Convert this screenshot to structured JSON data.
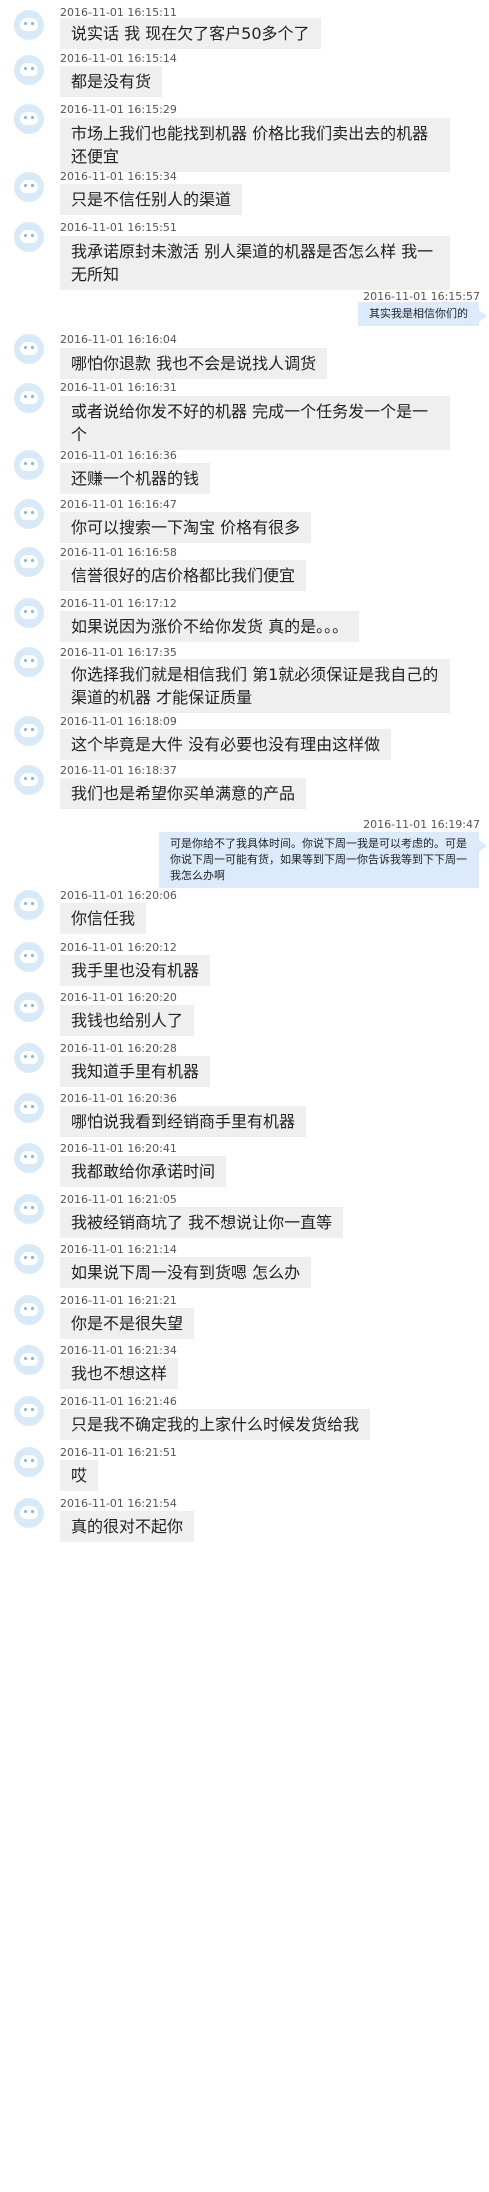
{
  "messages": [
    {
      "side": "left",
      "time": "2016-11-01 16:15:11",
      "text": "说实话 我 现在欠了客户50多个了"
    },
    {
      "side": "left",
      "time": "2016-11-01 16:15:14",
      "text": "都是没有货"
    },
    {
      "side": "left",
      "time": "2016-11-01 16:15:29",
      "text": "市场上我们也能找到机器  价格比我们卖出去的机器还便宜"
    },
    {
      "side": "left",
      "time": "2016-11-01 16:15:34",
      "text": "只是不信任别人的渠道"
    },
    {
      "side": "left",
      "time": "2016-11-01 16:15:51",
      "text": "我承诺原封未激活   别人渠道的机器是否怎么样 我一无所知"
    },
    {
      "side": "right",
      "time": "2016-11-01 16:15:57",
      "text": "其实我是相信你们的"
    },
    {
      "side": "left",
      "time": "2016-11-01 16:16:04",
      "text": "哪怕你退款 我也不会是说找人调货"
    },
    {
      "side": "left",
      "time": "2016-11-01 16:16:31",
      "text": "或者说给你发不好的机器  完成一个任务发一个是一个"
    },
    {
      "side": "left",
      "time": "2016-11-01 16:16:36",
      "text": "还赚一个机器的钱"
    },
    {
      "side": "left",
      "time": "2016-11-01 16:16:47",
      "text": "你可以搜索一下淘宝   价格有很多"
    },
    {
      "side": "left",
      "time": "2016-11-01 16:16:58",
      "text": "信誉很好的店价格都比我们便宜"
    },
    {
      "side": "left",
      "time": "2016-11-01 16:17:12",
      "text": "如果说因为涨价不给你发货 真的是。。。"
    },
    {
      "side": "left",
      "time": "2016-11-01 16:17:35",
      "text": "你选择我们就是相信我们  第1就必须保证是我自己的渠道的机器 才能保证质量"
    },
    {
      "side": "left",
      "time": "2016-11-01 16:18:09",
      "text": "这个毕竟是大件  没有必要也没有理由这样做"
    },
    {
      "side": "left",
      "time": "2016-11-01 16:18:37",
      "text": "我们也是希望你买单满意的产品"
    },
    {
      "side": "right",
      "time": "2016-11-01 16:19:47",
      "text": "可是你给不了我具体时间。你说下周一我是可以考虑的。可是你说下周一可能有货，如果等到下周一你告诉我等到下下周一   我怎么办啊"
    },
    {
      "side": "left",
      "time": "2016-11-01 16:20:06",
      "text": "你信任我"
    },
    {
      "side": "left",
      "time": "2016-11-01 16:20:12",
      "text": "我手里也没有机器"
    },
    {
      "side": "left",
      "time": "2016-11-01 16:20:20",
      "text": "我钱也给别人了"
    },
    {
      "side": "left",
      "time": "2016-11-01 16:20:28",
      "text": "我知道手里有机器"
    },
    {
      "side": "left",
      "time": "2016-11-01 16:20:36",
      "text": "哪怕说我看到经销商手里有机器"
    },
    {
      "side": "left",
      "time": "2016-11-01 16:20:41",
      "text": "我都敢给你承诺时间"
    },
    {
      "side": "left",
      "time": "2016-11-01 16:21:05",
      "text": "我被经销商坑了  我不想说让你一直等"
    },
    {
      "side": "left",
      "time": "2016-11-01 16:21:14",
      "text": "如果说下周一没有到货嗯 怎么办"
    },
    {
      "side": "left",
      "time": "2016-11-01 16:21:21",
      "text": "你是不是很失望"
    },
    {
      "side": "left",
      "time": "2016-11-01 16:21:34",
      "text": "我也不想这样"
    },
    {
      "side": "left",
      "time": "2016-11-01 16:21:46",
      "text": "只是我不确定我的上家什么时候发货给我"
    },
    {
      "side": "left",
      "time": "2016-11-01 16:21:51",
      "text": "哎"
    },
    {
      "side": "left",
      "time": "2016-11-01 16:21:54",
      "text": "真的很对不起你"
    }
  ]
}
